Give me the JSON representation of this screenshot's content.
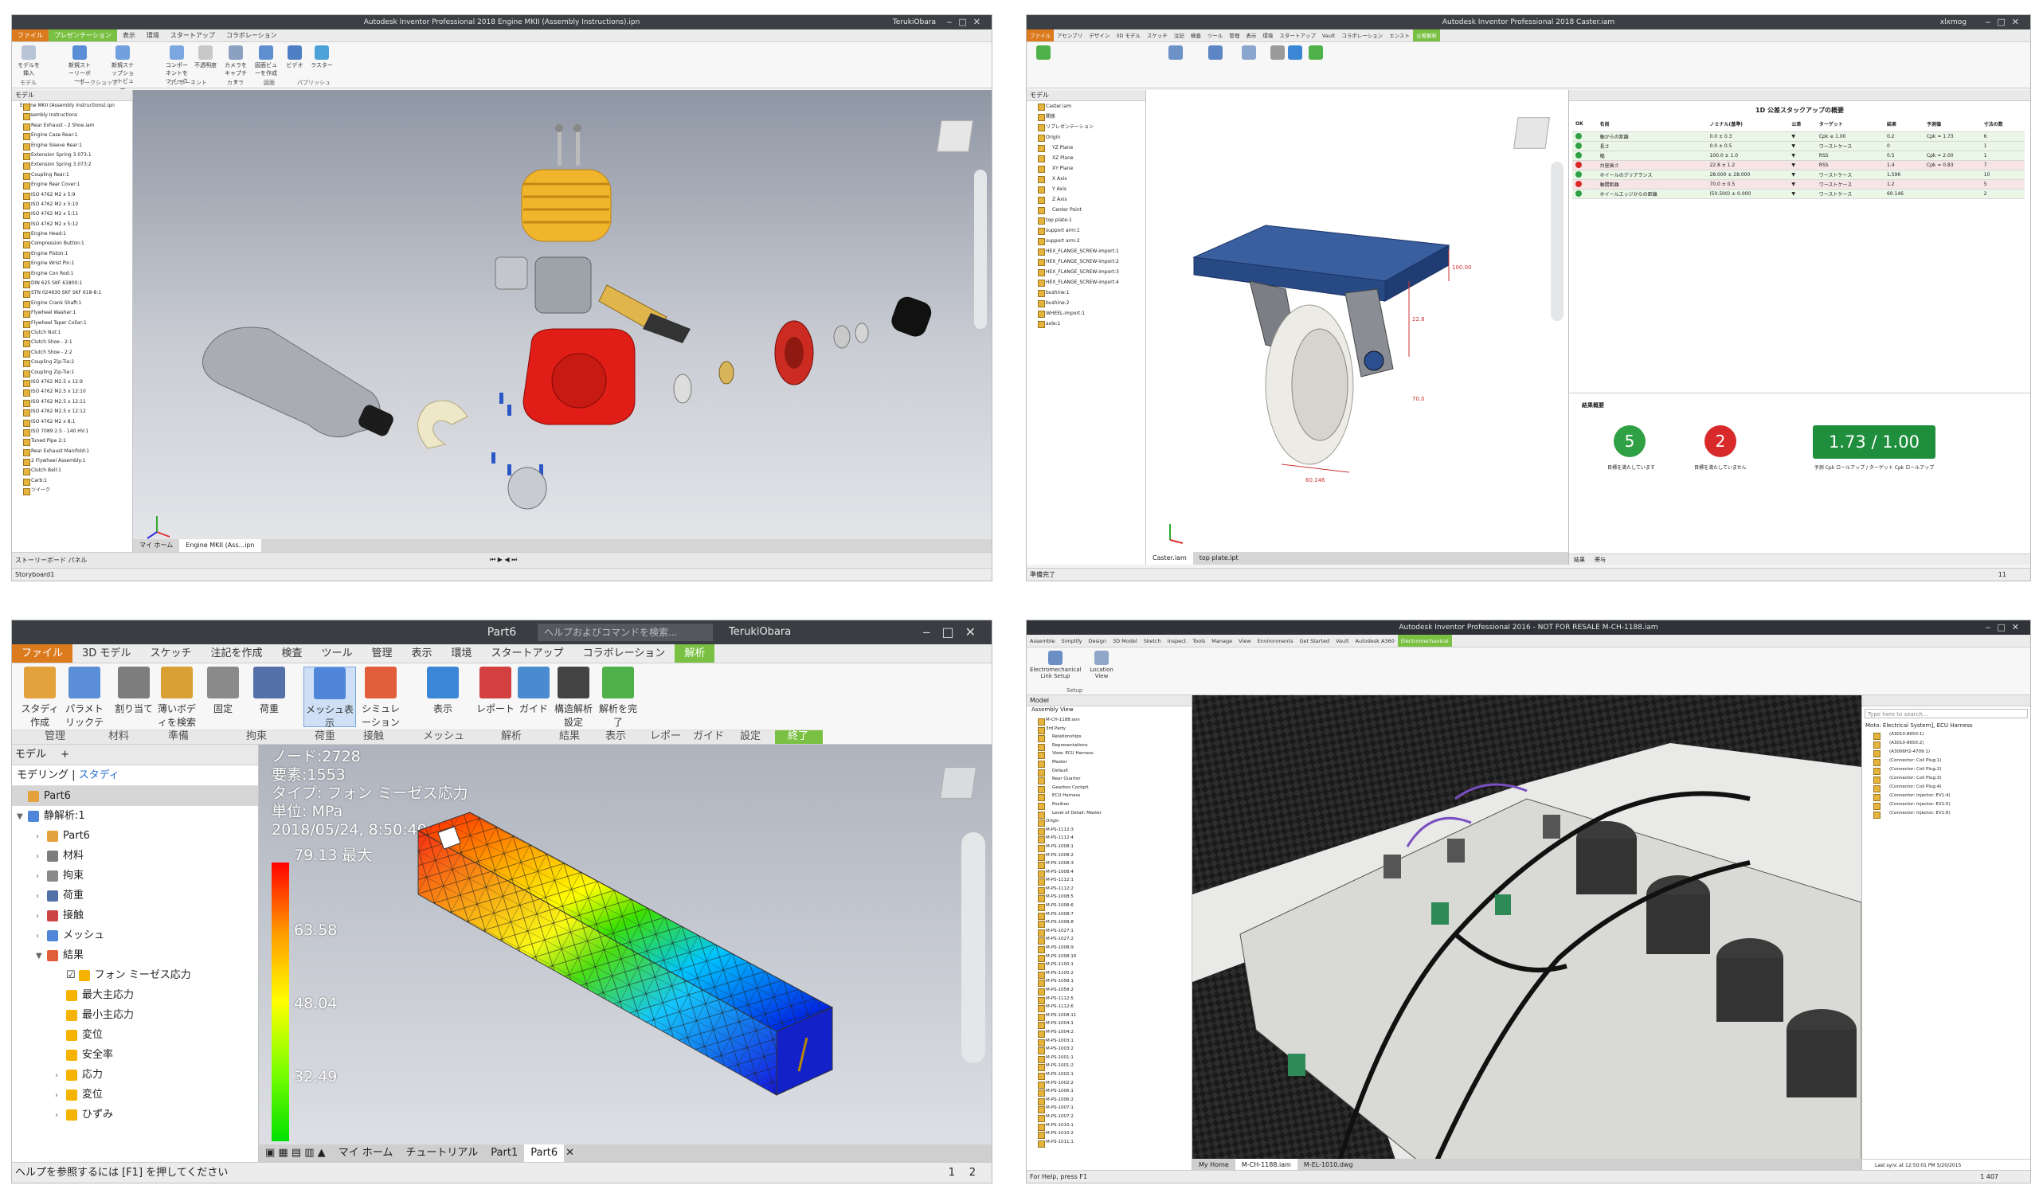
{
  "q1": {
    "title": "Autodesk Inventor Professional 2018   Engine MKII (Assembly Instructions).ipn",
    "user": "TerukiObara",
    "tabs": [
      "ファイル",
      "プレゼンテーション",
      "表示",
      "環境",
      "スタートアップ",
      "コラボレーション"
    ],
    "ribbon": [
      {
        "label": "モデルを挿入"
      },
      {
        "label": "新規ストーリーボード"
      },
      {
        "label": "新規スナップショットビュー"
      },
      {
        "label": "コンポーネントをツイーク"
      },
      {
        "label": "不透明度"
      },
      {
        "label": "カメラをキャプチャ"
      },
      {
        "label": "図面ビューを作成"
      },
      {
        "label": "ビデオ"
      },
      {
        "label": "ラスター"
      }
    ],
    "groups": [
      "モデル",
      "ワークショップ",
      "コンポーネント",
      "カメラ",
      "図面",
      "パブリッシュ"
    ],
    "browser_head": "モデル",
    "tree": [
      "Engine MKII (Assembly Instructions).ipn",
      "Assembly Instructions",
      "Rear Exhaust - 2 Shoe.iam",
      "Engine Case Rear:1",
      "Engine Sleeve Rear:1",
      "Extension Spring 3.073:1",
      "Extension Spring 3.073:2",
      "Coupling Rear:1",
      "Engine Rear Cover:1",
      "ISO 4762 M2 x 5:9",
      "ISO 4762 M2 x 5:10",
      "ISO 4762 M2 x 5:11",
      "ISO 4762 M2 x 5:12",
      "Engine Head:1",
      "Compression Button:1",
      "Engine Piston:1",
      "Engine Wrist Pin:1",
      "Engine Con Rod:1",
      "DIN 625 SKF 61800:1",
      "STN 024630 SKF SKF 618-8:1",
      "Engine Crank Shaft:1",
      "Flywheel Washer:1",
      "Flywheel Taper Collar:1",
      "Clutch Nut:1",
      "Clutch Shoe - 2:1",
      "Clutch Shoe - 2:2",
      "Coupling Zip-Tie:2",
      "Coupling Zip-Tie:1",
      "ISO 4762 M2.5 x 12:9",
      "ISO 4762 M2.5 x 12:10",
      "ISO 4762 M2.5 x 12:11",
      "ISO 4762 M2.5 x 12:12",
      "ISO 4762 M2 x 8:1",
      "ISO 7089 2.5 - 140 HV:1",
      "Tuned Pipe 2:1",
      "Rear Exhaust Manifold:1",
      "2 Flywheel Assembly:1",
      "Clutch Bell:1",
      "Carb:1",
      "ツイーク"
    ],
    "storyboard_tab": "ストーリーボード パネル",
    "storyboard_label": "Storyboard1",
    "doctabs": [
      "マイ ホーム",
      "Engine MKII (Ass...ipn"
    ]
  },
  "q2": {
    "title": "Autodesk Inventor Professional 2018   Caster.iam",
    "user": "xlxmog",
    "tabs": [
      "ファイル",
      "アセンブリ",
      "デザイン",
      "3D モデル",
      "スケッチ",
      "注記",
      "検査",
      "ツール",
      "管理",
      "表示",
      "環境",
      "スタートアップ",
      "Vault",
      "コラボレーション",
      "エンスト",
      "公差解析"
    ],
    "browser_head": "モデル",
    "tree": [
      "Caster.iam",
      "関係",
      "リプレゼンテーション",
      "Origin",
      "YZ Plane",
      "XZ Plane",
      "XY Plane",
      "X Axis",
      "Y Axis",
      "Z Axis",
      "Center Point",
      "top plate:1",
      "support arm:1",
      "support arm:2",
      "HEX_FLANGE_SCREW-import:1",
      "HEX_FLANGE_SCREW-import:2",
      "HEX_FLANGE_SCREW-import:3",
      "HEX_FLANGE_SCREW-import:4",
      "bushine:1",
      "bushine:2",
      "WHEEL-import:1",
      "axle:1"
    ],
    "panel_title": "1D 公差スタックアップの概要",
    "cols": [
      "OK",
      "名前",
      "ノミナル(基準)",
      "公差",
      "ターゲット",
      "結果",
      "予測値",
      "寸法の数"
    ],
    "rows": [
      {
        "name": "軸からの距離",
        "nom": "0.0 ± 0.3",
        "target": "Cpk ≥ 1.00",
        "res": "0.2",
        "pred": "Cpk = 1.73",
        "n": "6",
        "ok": true
      },
      {
        "name": "長さ",
        "nom": "0.0 ± 0.5",
        "target": "ワーストケース",
        "res": "0",
        "pred": "",
        "n": "1",
        "ok": true
      },
      {
        "name": "幅",
        "nom": "100.0 ± 1.0",
        "target": "RSS",
        "res": "0.5",
        "pred": "Cpk = 2.00",
        "n": "1",
        "ok": true
      },
      {
        "name": "台座高さ",
        "nom": "22.8 ± 1.2",
        "target": "RSS",
        "res": "1.4",
        "pred": "Cpk = 0.83",
        "n": "7",
        "ok": false
      },
      {
        "name": "ホイールのクリアランス",
        "nom": "28.000 ± 28.000",
        "target": "ワーストケース",
        "res": "1.596",
        "pred": "",
        "n": "10",
        "ok": true
      },
      {
        "name": "軸間距離",
        "nom": "70.0 ± 0.5",
        "target": "ワーストケース",
        "res": "1.2",
        "pred": "",
        "n": "5",
        "ok": false
      },
      {
        "name": "ホイールエッジからの距離",
        "nom": "(50.500) ± 0.000",
        "target": "ワーストケース",
        "res": "60.146",
        "pred": "",
        "n": "2",
        "ok": true
      }
    ],
    "summary_title": "結果概要",
    "met": "5",
    "met_label": "目標を満たしています",
    "unmet": "2",
    "unmet_label": "目標を満たしていません",
    "ratio": "1.73 / 1.00",
    "ratio_label": "予測 Cpk ロールアップ / ターゲット Cpk ロールアップ",
    "doctabs": [
      "Caster.iam",
      "top plate.ipt"
    ],
    "status": "準備完了",
    "status_right": "11",
    "bottom_tabs": [
      "結果",
      "寄与"
    ],
    "dims": [
      "100.00",
      "22.8",
      "60.146",
      "70.0"
    ]
  },
  "q3": {
    "title": "Part6",
    "search": "ヘルプおよびコマンドを検索...",
    "user": "TerukiObara",
    "tabs": [
      "ファイル",
      "3D モデル",
      "スケッチ",
      "注記を作成",
      "検査",
      "ツール",
      "管理",
      "表示",
      "環境",
      "スタートアップ",
      "コラボレーション",
      "解析"
    ],
    "ribbon": [
      {
        "label": "スタディ作成",
        "color": "#e3a23b"
      },
      {
        "label": "パラメトリックテーブル",
        "color": "#5a8ed6"
      },
      {
        "label": "割り当て",
        "color": "#7d7d7d"
      },
      {
        "label": "薄いボディを検索",
        "color": "#d9a035"
      },
      {
        "label": "固定",
        "color": "#8a8a8a"
      },
      {
        "label": "荷重",
        "color": "#5470a8"
      },
      {
        "label": "メッシュ表示",
        "color": "#4f86d9"
      },
      {
        "label": "シミュレーション",
        "color": "#e25d3a"
      },
      {
        "label": "表示",
        "color": "#3c86d6"
      },
      {
        "label": "レポート",
        "color": "#d34040"
      },
      {
        "label": "ガイド",
        "color": "#4a8bd0"
      },
      {
        "label": "構造解析設定",
        "color": "#444"
      },
      {
        "label": "解析を完了",
        "color": "#4fb14a"
      }
    ],
    "groups": [
      "管理",
      "材料",
      "準備",
      "拘束",
      "荷重",
      "接触",
      "メッシュ",
      "解析",
      "結果",
      "表示",
      "レポート",
      "ガイド",
      "設定",
      "終了"
    ],
    "browser_tabs": [
      "モデル",
      "+"
    ],
    "browser_sub": [
      "モデリング",
      "スタディ"
    ],
    "tree": [
      {
        "label": "Part6",
        "lvl": 0,
        "icon": "#e3a23b"
      },
      {
        "label": "静解析:1",
        "lvl": 0,
        "icon": "#4f86d9"
      },
      {
        "label": "Part6",
        "lvl": 1,
        "icon": "#e3a23b"
      },
      {
        "label": "材料",
        "lvl": 1,
        "icon": "#7d7d7d"
      },
      {
        "label": "拘束",
        "lvl": 1,
        "icon": "#8a8a8a"
      },
      {
        "label": "荷重",
        "lvl": 1,
        "icon": "#5470a8"
      },
      {
        "label": "接触",
        "lvl": 1,
        "icon": "#c44"
      },
      {
        "label": "メッシュ",
        "lvl": 1,
        "icon": "#4f86d9"
      },
      {
        "label": "結果",
        "lvl": 1,
        "icon": "#e25d3a"
      },
      {
        "label": "フォン ミーゼス応力",
        "lvl": 2,
        "icon": "#f5b300"
      },
      {
        "label": "最大主応力",
        "lvl": 2,
        "icon": "#f5b300"
      },
      {
        "label": "最小主応力",
        "lvl": 2,
        "icon": "#f5b300"
      },
      {
        "label": "変位",
        "lvl": 2,
        "icon": "#f5b300"
      },
      {
        "label": "安全率",
        "lvl": 2,
        "icon": "#f5b300"
      },
      {
        "label": "応力",
        "lvl": 2,
        "icon": "#f5b300"
      },
      {
        "label": "変位",
        "lvl": 2,
        "icon": "#f5b300"
      },
      {
        "label": "ひずみ",
        "lvl": 2,
        "icon": "#f5b300"
      }
    ],
    "info": [
      "ノード:2728",
      "要素:1553",
      "タイプ: フォン ミーゼス応力",
      "単位: MPa",
      "2018/05/24, 8:50:40"
    ],
    "legend_max": "79.13 最大",
    "legend_vals": [
      "63.58",
      "48.04",
      "32.49"
    ],
    "doctabs": [
      "マイ ホーム",
      "チュートリアル",
      "Part1",
      "Part6"
    ],
    "status": "ヘルプを参照するには [F1] を押してください",
    "page_nums": [
      "1",
      "2"
    ]
  },
  "q4": {
    "title": "Autodesk Inventor Professional 2016 - NOT FOR RESALE   M-CH-1188.iam",
    "tabs": [
      "Assemble",
      "Simplify",
      "Design",
      "3D Model",
      "Sketch",
      "Inspect",
      "Tools",
      "Manage",
      "View",
      "Environments",
      "Get Started",
      "Vault",
      "Autodesk A360",
      "Electromechanical"
    ],
    "ribbon": [
      "Electromechanical Link Setup",
      "Location View"
    ],
    "group": "Setup",
    "browser_head": "Model",
    "subhead": "Assembly View",
    "tree": [
      "M-CH-1188.iam",
      "3rd Party",
      "Relationships",
      "Representations",
      "View: ECU Harness",
      "Master",
      "Default",
      "Rear Quarter",
      "Gearbox Cockpit",
      "ECU Harness",
      "Position",
      "Level of Detail: Master",
      "Origin",
      "M-PS-1112:3",
      "M-PS-1112:4",
      "M-PS-1008:1",
      "M-PS-1008:2",
      "M-PS-1008:3",
      "M-PS-1008:4",
      "M-PS-1112:1",
      "M-PS-1112:2",
      "M-PS-1008:5",
      "M-PS-1008:6",
      "M-PS-1008:7",
      "M-PS-1008:8",
      "M-PS-1027:1",
      "M-PS-1027:2",
      "M-PS-1008:9",
      "M-PS-1008:10",
      "M-PS-1100:1",
      "M-PS-1100:2",
      "M-PS-1058:1",
      "M-PS-1058:2",
      "M-PS-1112:5",
      "M-PS-1112:6",
      "M-PS-1008:11",
      "M-PS-1004:1",
      "M-PS-1004:2",
      "M-PS-1003:1",
      "M-PS-1003:2",
      "M-PS-1001:1",
      "M-PS-1001:2",
      "M-PS-1002:1",
      "M-PS-1002:2",
      "M-PS-1006:1",
      "M-PS-1006:2",
      "M-PS-1007:1",
      "M-PS-1007:2",
      "M-PS-1010:1",
      "M-PS-1010:2",
      "M-PS-1011:1"
    ],
    "right_search": "Type here to search...",
    "right_head": "Moto: Electrical System], ECU Harness",
    "right_tree": [
      "(A3010-8650:1)",
      "(A3010-8650:2)",
      "(A3006H2-4709:1)",
      "(Connector: Coil Plug:1)",
      "(Connector: Coil Plug:2)",
      "(Connector: Coil Plug:3)",
      "(Connector: Coil Plug:4)",
      "(Connector: Injector: EV1:4)",
      "(Connector: Injector: EV1:5)",
      "(Connector: Injector: EV1:6)"
    ],
    "sync": "Last sync at 12:50:01 PM 5/20/2015",
    "doctabs": [
      "My Home",
      "M-CH-1188.iam",
      "M-EL-1010.dwg"
    ],
    "status": "For Help, press F1",
    "status_right": "1 407"
  }
}
